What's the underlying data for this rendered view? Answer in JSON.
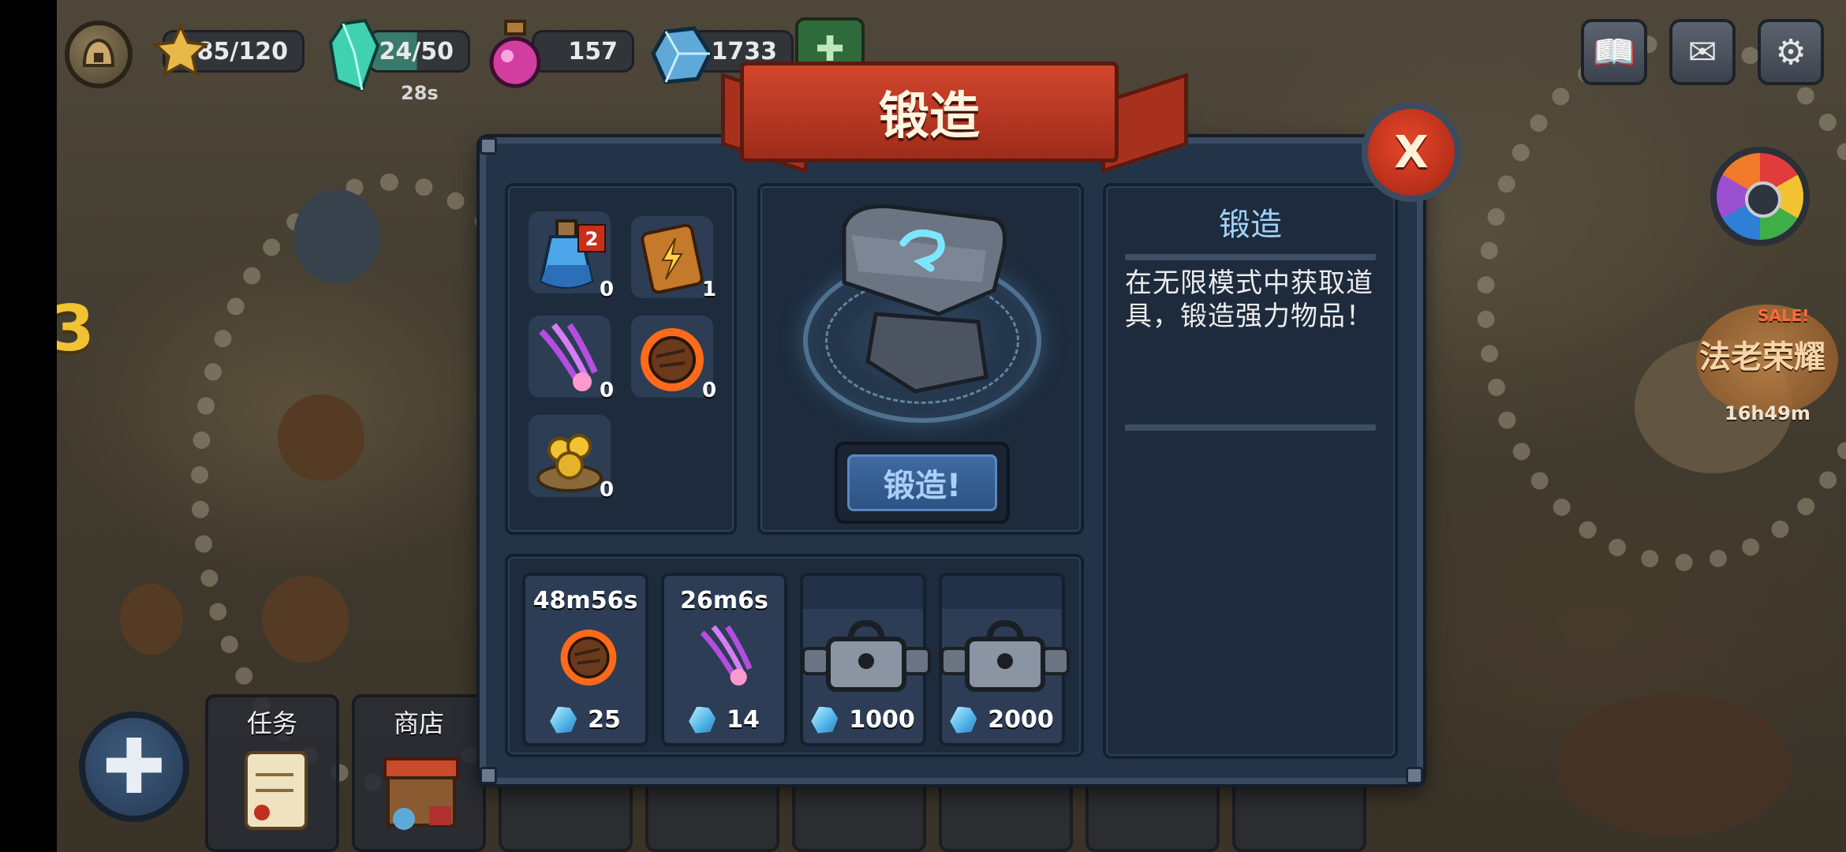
{
  "hud": {
    "stars": "85/120",
    "energy": "24/50",
    "energy_timer": "28s",
    "potions": "157",
    "gems": "1733"
  },
  "side": {
    "level_digit": "3"
  },
  "event": {
    "sale_tag": "SALE!",
    "title": "法老荣耀",
    "timer": "16h49m"
  },
  "dialog": {
    "title": "锻造",
    "close_label": "X",
    "inventory": [
      {
        "icon": "mana-potion-icon",
        "badge": "2",
        "count": "0"
      },
      {
        "icon": "lightning-card-icon",
        "count": "1"
      },
      {
        "icon": "purple-claw-icon",
        "count": "0"
      },
      {
        "icon": "meteor-icon",
        "count": "0"
      },
      {
        "icon": "gold-coin-pile-icon",
        "count": "0"
      }
    ],
    "forge_button": "锻造!",
    "info": {
      "title": "锻造",
      "description": "在无限模式中获取道具，锻造强力物品！"
    },
    "slots": [
      {
        "time": "48m56s",
        "item": "meteor-icon",
        "cost": "25"
      },
      {
        "time": "26m6s",
        "item": "purple-claw-icon",
        "cost": "14"
      },
      {
        "locked": true,
        "cost": "1000"
      },
      {
        "locked": true,
        "cost": "2000"
      }
    ]
  },
  "bottom_tabs": [
    {
      "label": "任务"
    },
    {
      "label": "商店"
    }
  ],
  "colors": {
    "banner": "#c63d26",
    "panel": "#243448",
    "info_title": "#9fd2f7",
    "forge_button": "#3f6aa1"
  }
}
